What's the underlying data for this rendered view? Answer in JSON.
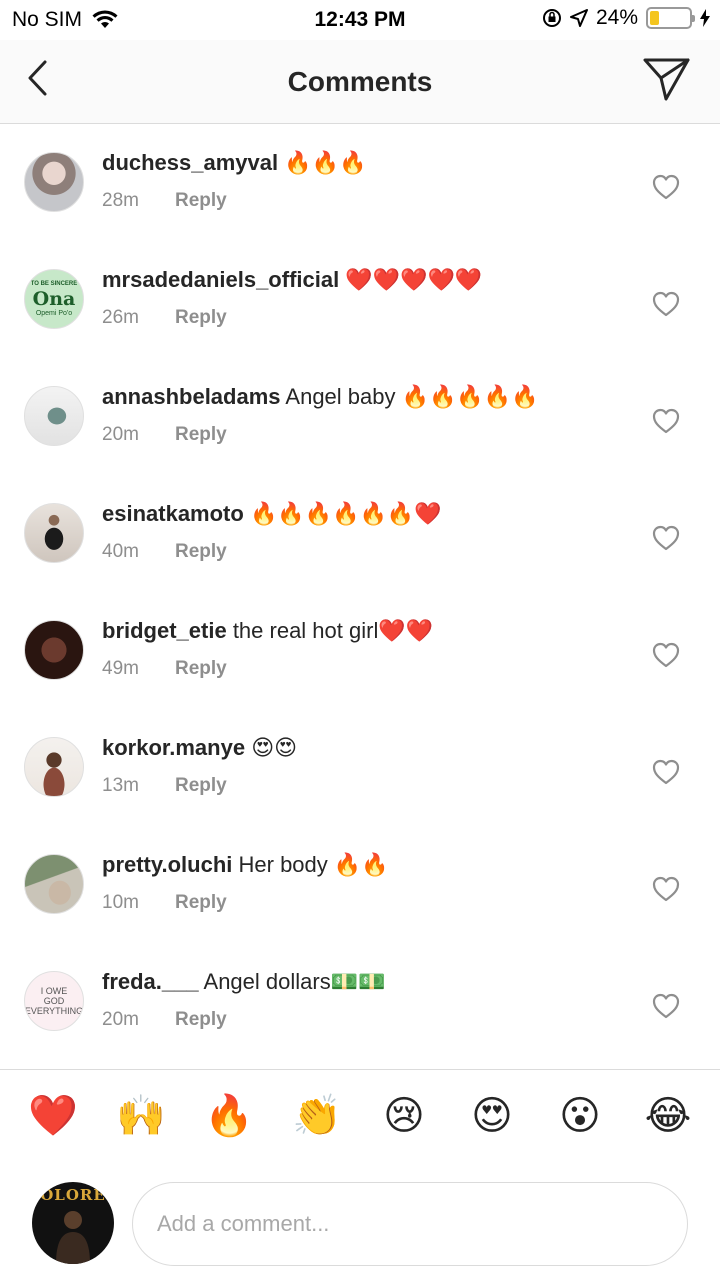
{
  "status_bar": {
    "carrier": "No SIM",
    "time": "12:43 PM",
    "battery_percent": "24%",
    "battery_level": 0.24,
    "battery_color": "#f4c51f"
  },
  "header": {
    "title": "Comments",
    "back_icon": "chevron-left-icon",
    "send_icon": "paper-plane-icon"
  },
  "comments": [
    {
      "user": "duchess_amyval",
      "text": " 🔥🔥🔥",
      "time": "28m",
      "reply": "Reply"
    },
    {
      "user": "mrsadedaniels_official",
      "text": " ❤️❤️❤️❤️❤️",
      "time": "26m",
      "reply": "Reply",
      "avatar_text": {
        "top": "TO BE SINCERE",
        "mid": "Ona",
        "bot": "Opemi Po'o"
      }
    },
    {
      "user": "annashbeladams",
      "text": " Angel  baby 🔥🔥🔥🔥🔥",
      "time": "20m",
      "reply": "Reply"
    },
    {
      "user": "esinatkamoto",
      "text": " 🔥🔥🔥🔥🔥🔥❤️",
      "time": "40m",
      "reply": "Reply"
    },
    {
      "user": "bridget_etie",
      "text": " the real  hot girl❤️❤️",
      "time": "49m",
      "reply": "Reply"
    },
    {
      "user": "korkor.manye",
      "text": " 😍😍",
      "time": "13m",
      "reply": "Reply"
    },
    {
      "user": "pretty.oluchi",
      "text": " Her body 🔥🔥",
      "time": "10m",
      "reply": "Reply"
    },
    {
      "user": "freda.___",
      "text": " Angel dollars💵💵",
      "time": "20m",
      "reply": "Reply",
      "avatar_text": {
        "top": "I OWE",
        "mid": "GOD",
        "bot": "EVERYTHING"
      }
    }
  ],
  "reactions": [
    "❤️",
    "🙌",
    "🔥",
    "👏",
    "😢",
    "😍",
    "😮",
    "😂"
  ],
  "composer": {
    "placeholder": "Add a comment...",
    "avatar_text": "OLORE"
  }
}
